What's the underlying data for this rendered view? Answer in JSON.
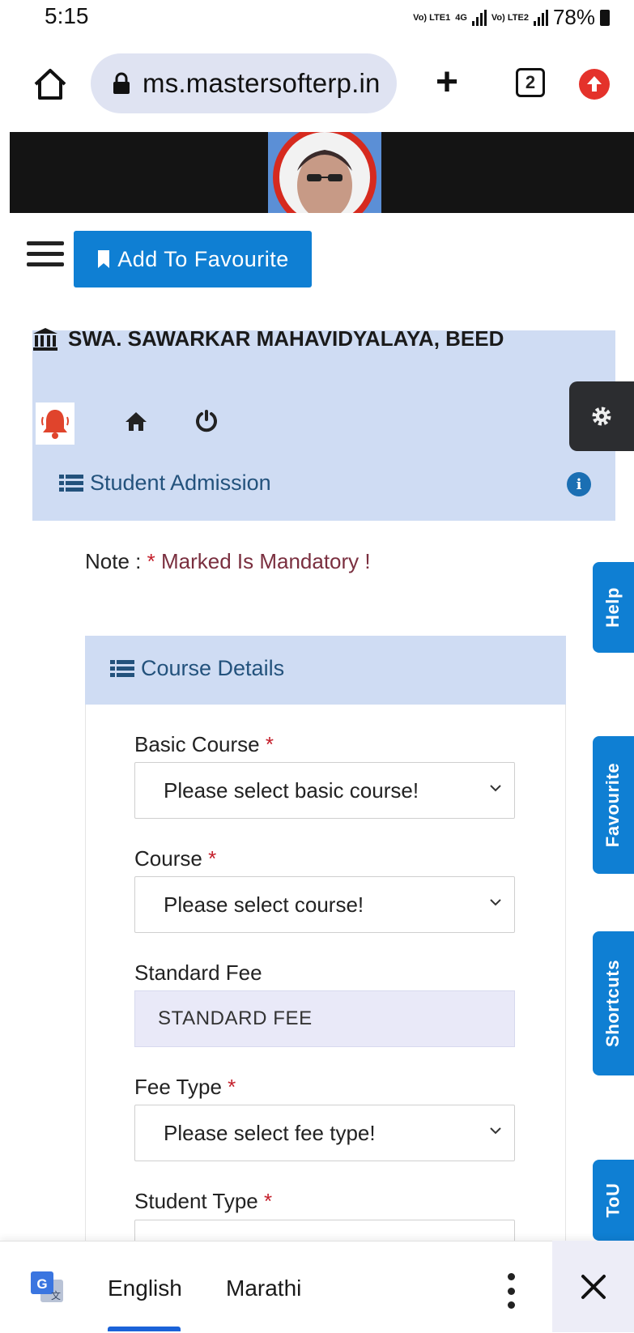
{
  "status_bar": {
    "time": "5:15",
    "sim1_label": "Vo) LTE1",
    "net_label": "4G",
    "sim2_label": "Vo) LTE2",
    "battery": "78%"
  },
  "browser": {
    "url": "ms.mastersofterp.in",
    "tab_count": "2"
  },
  "toolbar": {
    "add_favourite_label": "Add To Favourite"
  },
  "college": {
    "name": "SWA. SAWARKAR MAHAVIDYALAYA, BEED"
  },
  "section": {
    "title": "Student Admission"
  },
  "note": {
    "prefix": "Note :",
    "star": "*",
    "text": "Marked Is Mandatory !"
  },
  "course_details": {
    "title": "Course Details",
    "basic_course": {
      "label": "Basic Course",
      "req": "*",
      "value": "Please select basic course!"
    },
    "course": {
      "label": "Course",
      "req": "*",
      "value": "Please select course!"
    },
    "standard_fee": {
      "label": "Standard Fee",
      "value": "STANDARD FEE"
    },
    "fee_type": {
      "label": "Fee Type",
      "req": "*",
      "value": "Please select fee type!"
    },
    "student_type": {
      "label": "Student Type",
      "req": "*"
    }
  },
  "side_tabs": {
    "help": "Help",
    "favourite": "Favourite",
    "shortcuts": "Shortcuts",
    "tou": "ToU"
  },
  "translate": {
    "lang1": "English",
    "lang2": "Marathi"
  },
  "colors": {
    "accent": "#0f7fd3",
    "panel": "#cfdcf3",
    "required": "#c41f2b",
    "heading": "#23527c"
  }
}
